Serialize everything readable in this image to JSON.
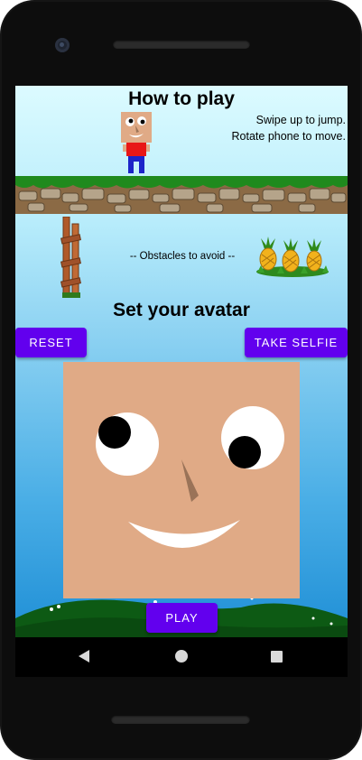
{
  "screen": {
    "how_to_play_title": "How to play",
    "instruction_jump": "Swipe up to jump.",
    "instruction_move": "Rotate phone to move.",
    "obstacles_label": "-- Obstacles to avoid --",
    "set_avatar_title": "Set your avatar"
  },
  "buttons": {
    "reset_label": "RESET",
    "take_selfie_label": "TAKE SELFIE",
    "play_label": "PLAY"
  },
  "colors": {
    "button_accent": "#6200ee",
    "avatar_skin": "#e0aa86",
    "grass": "#1f8a1d"
  },
  "icons": {
    "nav_back": "back-triangle-icon",
    "nav_home": "home-circle-icon",
    "nav_recent": "recent-apps-square-icon"
  }
}
